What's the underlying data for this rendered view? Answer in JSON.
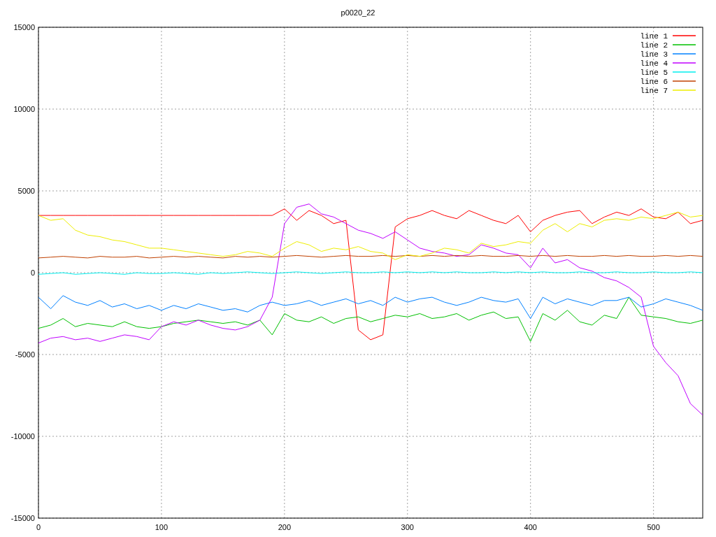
{
  "chart_data": {
    "type": "line",
    "title": "p0020_22",
    "grid": true,
    "legend": true,
    "x": [
      0,
      10,
      20,
      30,
      40,
      50,
      60,
      70,
      80,
      90,
      100,
      110,
      120,
      130,
      140,
      150,
      160,
      170,
      180,
      190,
      200,
      210,
      220,
      230,
      240,
      250,
      260,
      270,
      280,
      290,
      300,
      310,
      320,
      330,
      340,
      350,
      360,
      370,
      380,
      390,
      400,
      410,
      420,
      430,
      440,
      450,
      460,
      470,
      480,
      490,
      500,
      510,
      520,
      530,
      540
    ],
    "xlim": [
      0,
      540
    ],
    "ylim": [
      -15000,
      15000
    ],
    "xticks": [
      0,
      100,
      200,
      300,
      400,
      500
    ],
    "yticks": [
      -15000,
      -10000,
      -5000,
      0,
      5000,
      10000,
      15000
    ],
    "series": [
      {
        "name": "line 1",
        "color": "#ff0000",
        "values": [
          3500,
          3500,
          3500,
          3500,
          3500,
          3500,
          3500,
          3500,
          3500,
          3500,
          3500,
          3500,
          3500,
          3500,
          3500,
          3500,
          3500,
          3500,
          3500,
          3500,
          3900,
          3200,
          3800,
          3500,
          3000,
          3200,
          -3500,
          -4100,
          -3800,
          2800,
          3300,
          3500,
          3800,
          3500,
          3300,
          3800,
          3500,
          3200,
          3000,
          3500,
          2500,
          3200,
          3500,
          3700,
          3800,
          3000,
          3400,
          3700,
          3500,
          3900,
          3400,
          3300,
          3700,
          3000,
          3200
        ]
      },
      {
        "name": "line 2",
        "color": "#00c000",
        "values": [
          -3400,
          -3200,
          -2800,
          -3300,
          -3100,
          -3200,
          -3300,
          -3000,
          -3300,
          -3400,
          -3300,
          -3100,
          -3000,
          -2900,
          -3000,
          -3100,
          -3000,
          -3200,
          -2900,
          -3800,
          -2500,
          -2900,
          -3000,
          -2700,
          -3100,
          -2800,
          -2700,
          -3000,
          -2800,
          -2600,
          -2700,
          -2500,
          -2800,
          -2700,
          -2500,
          -2900,
          -2600,
          -2400,
          -2800,
          -2700,
          -4200,
          -2500,
          -2900,
          -2300,
          -3000,
          -3200,
          -2600,
          -2800,
          -1500,
          -2600,
          -2700,
          -2800,
          -3000,
          -3100,
          -2900
        ]
      },
      {
        "name": "line 3",
        "color": "#0080ff",
        "values": [
          -1500,
          -2200,
          -1400,
          -1800,
          -2000,
          -1700,
          -2100,
          -1900,
          -2200,
          -2000,
          -2300,
          -2000,
          -2200,
          -1900,
          -2100,
          -2300,
          -2200,
          -2400,
          -2000,
          -1800,
          -2000,
          -1900,
          -1700,
          -2000,
          -1800,
          -1600,
          -1900,
          -1700,
          -2000,
          -1500,
          -1800,
          -1600,
          -1500,
          -1800,
          -2000,
          -1800,
          -1500,
          -1700,
          -1800,
          -1600,
          -2800,
          -1500,
          -1900,
          -1600,
          -1800,
          -2000,
          -1700,
          -1700,
          -1500,
          -2100,
          -1900,
          -1600,
          -1800,
          -2000,
          -2300
        ]
      },
      {
        "name": "line 4",
        "color": "#c000ff",
        "values": [
          -4300,
          -4000,
          -3900,
          -4100,
          -4000,
          -4200,
          -4000,
          -3800,
          -3900,
          -4100,
          -3300,
          -3000,
          -3200,
          -2900,
          -3200,
          -3400,
          -3500,
          -3300,
          -2900,
          -1500,
          3000,
          4000,
          4200,
          3600,
          3400,
          3000,
          2600,
          2400,
          2100,
          2500,
          2000,
          1500,
          1300,
          1200,
          1000,
          1100,
          1700,
          1500,
          1200,
          1100,
          300,
          1500,
          600,
          800,
          300,
          100,
          -300,
          -500,
          -900,
          -1500,
          -4500,
          -5500,
          -6300,
          -8000,
          -8700
        ]
      },
      {
        "name": "line 5",
        "color": "#00eeee",
        "values": [
          -100,
          -50,
          0,
          -100,
          -50,
          0,
          -50,
          -100,
          0,
          -50,
          -50,
          0,
          -50,
          -100,
          0,
          -50,
          0,
          50,
          0,
          -50,
          0,
          50,
          0,
          -50,
          0,
          50,
          0,
          0,
          50,
          0,
          50,
          0,
          50,
          0,
          50,
          0,
          0,
          50,
          0,
          50,
          0,
          50,
          0,
          0,
          50,
          0,
          0,
          50,
          0,
          0,
          50,
          0,
          0,
          50,
          0
        ]
      },
      {
        "name": "line 6",
        "color": "#c04000",
        "values": [
          900,
          950,
          1000,
          950,
          900,
          1000,
          950,
          950,
          1000,
          900,
          950,
          1000,
          950,
          1000,
          950,
          900,
          1000,
          950,
          1000,
          950,
          1000,
          1050,
          1000,
          950,
          1000,
          1050,
          1000,
          1000,
          1050,
          1000,
          1050,
          1000,
          1050,
          1000,
          1050,
          1000,
          1050,
          1000,
          1000,
          1050,
          1000,
          1050,
          1000,
          1050,
          1000,
          1000,
          1050,
          1000,
          1050,
          1000,
          1000,
          1050,
          1000,
          1050,
          1000
        ]
      },
      {
        "name": "line 7",
        "color": "#eeee00",
        "values": [
          3500,
          3200,
          3300,
          2600,
          2300,
          2200,
          2000,
          1900,
          1700,
          1500,
          1500,
          1400,
          1300,
          1200,
          1100,
          1000,
          1100,
          1300,
          1200,
          1000,
          1500,
          1900,
          1700,
          1300,
          1500,
          1400,
          1600,
          1300,
          1200,
          800,
          1100,
          1000,
          1200,
          1500,
          1400,
          1200,
          1800,
          1600,
          1700,
          1900,
          1800,
          2600,
          3000,
          2500,
          3000,
          2800,
          3200,
          3300,
          3200,
          3400,
          3300,
          3500,
          3700,
          3400,
          3500
        ]
      }
    ]
  }
}
